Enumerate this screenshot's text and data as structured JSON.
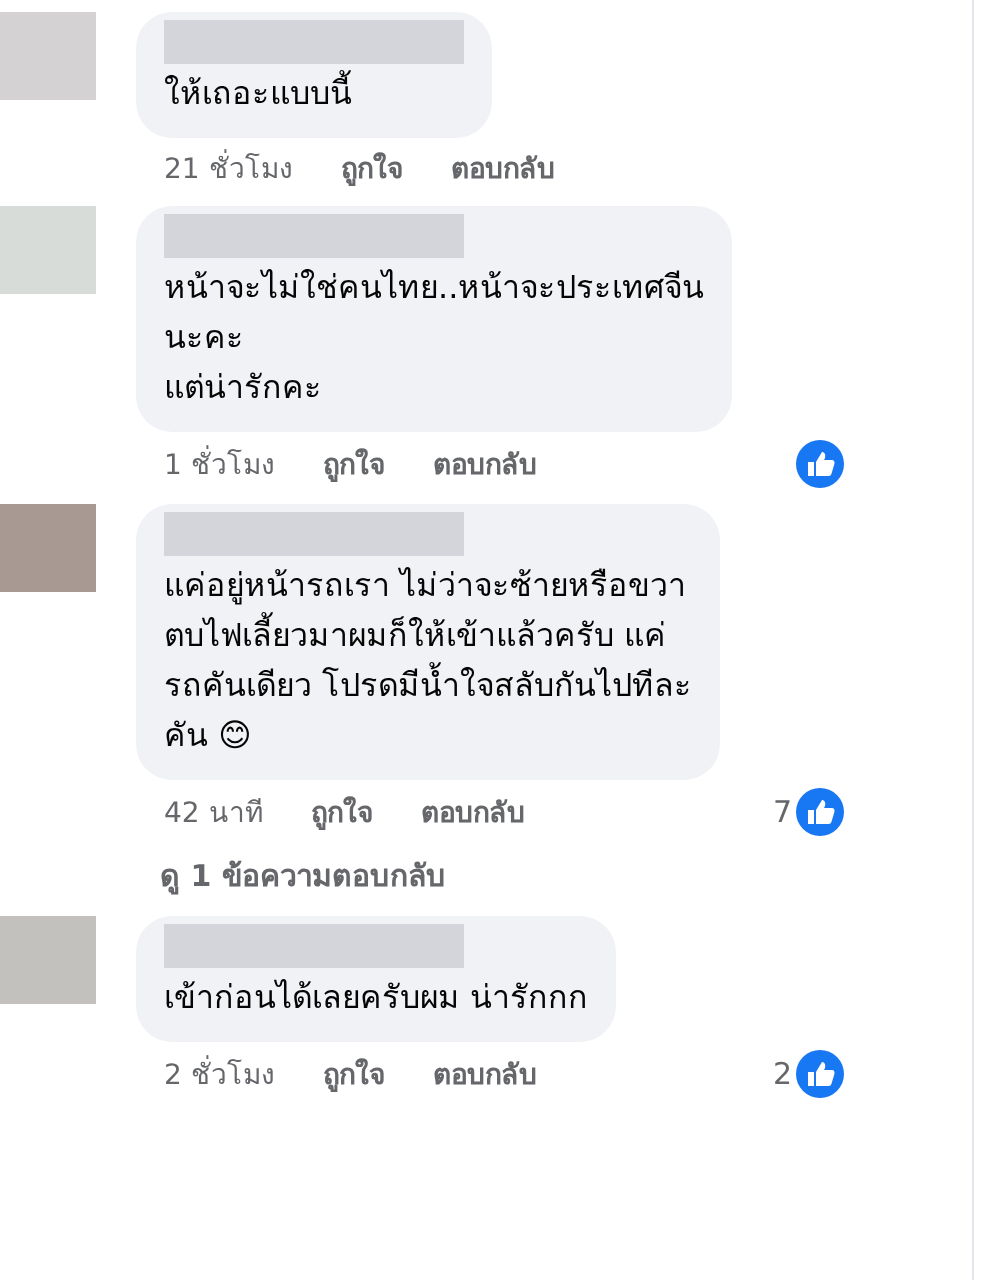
{
  "comments": [
    {
      "kind": "comment",
      "text": "ให้เถอะแบบนี้",
      "time": "21 ชั่วโมง",
      "like": "ถูกใจ",
      "reply": "ตอบกลับ",
      "reaction": false
    },
    {
      "kind": "comment",
      "text": "หน้าจะไม่ใช่คนไทย..หน้าจะประเทศจีน\nนะคะ\nแต่น่ารักคะ",
      "time": "1 ชั่วโมง",
      "like": "ถูกใจ",
      "reply": "ตอบกลับ",
      "reaction": true
    },
    {
      "kind": "comment",
      "text": "แค่อยู่หน้ารถเรา ไม่ว่าจะซ้ายหรือขวา\nตบไฟเลี้ยวมาผมก็ให้เข้าแล้วครับ แค่\nรถคันเดียว โปรดมีน้ำใจสลับกันไปทีละ\nคัน 😊",
      "time": "42 นาที",
      "like": "ถูกใจ",
      "reply": "ตอบกลับ",
      "reaction": true,
      "reaction_count": "7"
    },
    {
      "kind": "replies",
      "text": "ดู 1 ข้อความตอบกลับ"
    },
    {
      "kind": "comment",
      "text": "เข้าก่อนได้เลยครับผม น่ารักกก",
      "time": "2 ชั่วโมง",
      "like": "ถูกใจ",
      "reply": "ตอบกลับ",
      "reaction": true,
      "reaction_count": "2"
    }
  ]
}
